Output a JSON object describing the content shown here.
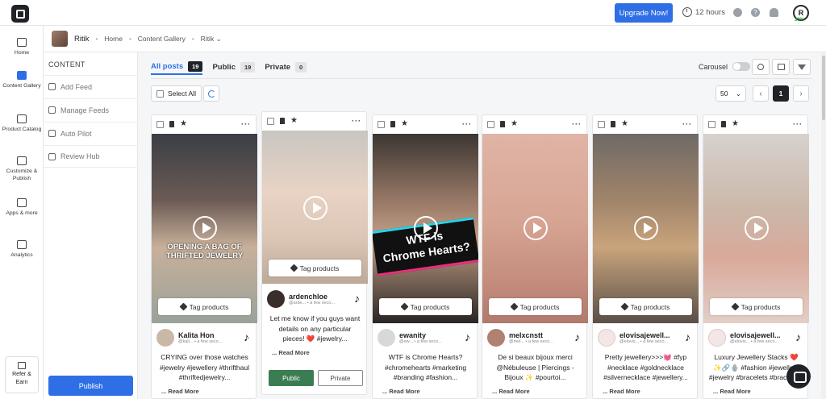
{
  "topbar": {
    "upgrade_label": "Upgrade Now!",
    "timer_text": "12 hours",
    "avatar_letter": "R",
    "avatar_progress": "30%"
  },
  "nav": {
    "items": [
      {
        "label": "Home",
        "icon": "home-icon"
      },
      {
        "label": "Content Gallery",
        "icon": "gallery-icon",
        "active": true
      },
      {
        "label": "Product Catalog",
        "icon": "bag-icon"
      },
      {
        "label": "Customize & Publish",
        "icon": "send-icon"
      },
      {
        "label": "Apps & more",
        "icon": "apps-icon"
      },
      {
        "label": "Analytics",
        "icon": "chart-icon"
      }
    ],
    "refer_label": "Refer & Earn"
  },
  "breadcrumb": {
    "account": "Ritik",
    "items": [
      "Home",
      "Content Gallery",
      "Ritik"
    ]
  },
  "sidepanel": {
    "heading": "CONTENT",
    "items": [
      "Add Feed",
      "Manage Feeds",
      "Auto Pilot",
      "Review Hub"
    ],
    "publish_label": "Publish"
  },
  "tabs": [
    {
      "label": "All posts",
      "count": "19"
    },
    {
      "label": "Public",
      "count": "19"
    },
    {
      "label": "Private",
      "count": "0"
    }
  ],
  "toolbar": {
    "carousel_label": "Carousel",
    "select_all_label": "Select All",
    "per_page": "50",
    "current_page": "1"
  },
  "tag_products_label": "Tag products",
  "read_more_label": "Read More",
  "public_label": "Public",
  "private_label": "Private",
  "cards": [
    {
      "name": "Kalita Hon",
      "handle": "@kali... • a few seco...",
      "caption": "CRYING over those watches #jewelry #jewellery #thrifthaul #thriftedjewelry...",
      "overlay": "OPENING A BAG OF THRIFTED JEWELRY"
    },
    {
      "name": "ardenchloe",
      "handle": "@arde... • a few seco...",
      "caption": "Let me know if you guys want details on any particular pieces! ❤️ #jewelry...",
      "overlay": ""
    },
    {
      "name": "ewanity",
      "handle": "@ew... • a few seco...",
      "caption": "WTF is Chrome Hearts? #chromehearts #marketing #branding #fashion...",
      "overlay_line1": "WTF is",
      "overlay_line2": "Chrome Hearts?"
    },
    {
      "name": "melxcnstt",
      "handle": "@mel... • a few seco...",
      "caption": "De si beaux bijoux merci @Nébuleuse | Piercings - Bijoux ✨ #pourtoi...",
      "overlay": ""
    },
    {
      "name": "elovisajewell...",
      "handle": "@elovis... • a few seco...",
      "caption": "Pretty jewellery>>>💓 #fyp #necklace #goldnecklace #silvernecklace #jewellery...",
      "overlay": ""
    },
    {
      "name": "elovisajewell...",
      "handle": "@elovis... • a few seco...",
      "caption": "Luxury Jewellery Stacks ❤️✨🔗🪬 #fashion #jewellery #jewelry #bracelets #bracelet...",
      "overlay": ""
    }
  ]
}
